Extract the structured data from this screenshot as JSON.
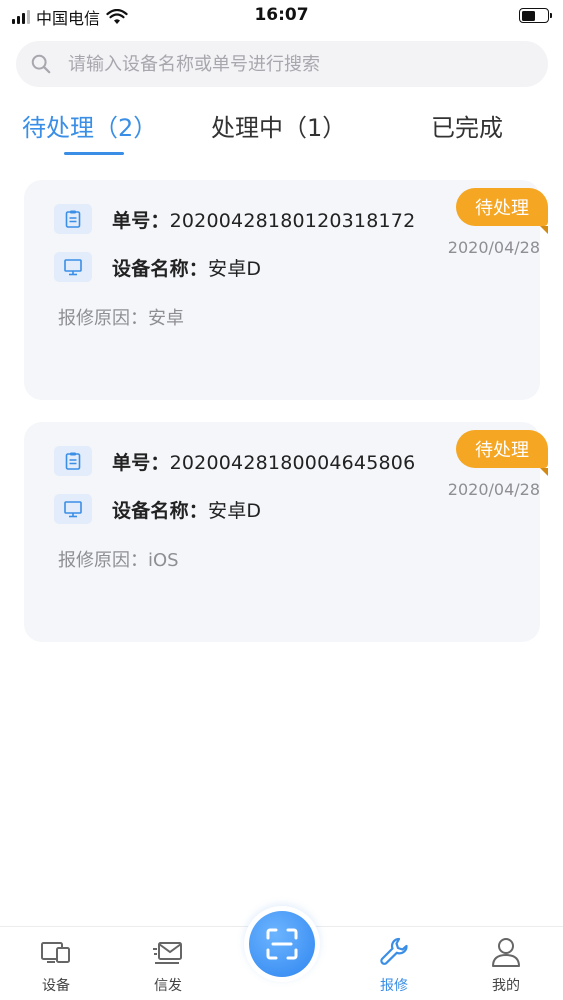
{
  "status_bar": {
    "carrier": "中国电信",
    "time": "16:07"
  },
  "search": {
    "placeholder": "请输入设备名称或单号进行搜索"
  },
  "tabs": [
    {
      "label": "待处理（2）"
    },
    {
      "label": "处理中（1）"
    },
    {
      "label": "已完成"
    }
  ],
  "orders": [
    {
      "number_label": "单号：",
      "number": "20200428180120318172",
      "device_label": "设备名称：",
      "device": "安卓D",
      "reason_label": "报修原因：",
      "reason": "安卓",
      "status": "待处理",
      "date": "2020/04/28"
    },
    {
      "number_label": "单号：",
      "number": "20200428180004645806",
      "device_label": "设备名称：",
      "device": "安卓D",
      "reason_label": "报修原因：",
      "reason": "iOS",
      "status": "待处理",
      "date": "2020/04/28"
    }
  ],
  "nav": [
    {
      "label": "设备"
    },
    {
      "label": "信发"
    },
    {
      "label": "报修"
    },
    {
      "label": "我的"
    }
  ],
  "colors": {
    "accent": "#3a8ee6",
    "badge": "#f5a623",
    "card_bg": "#f4f6fa"
  }
}
